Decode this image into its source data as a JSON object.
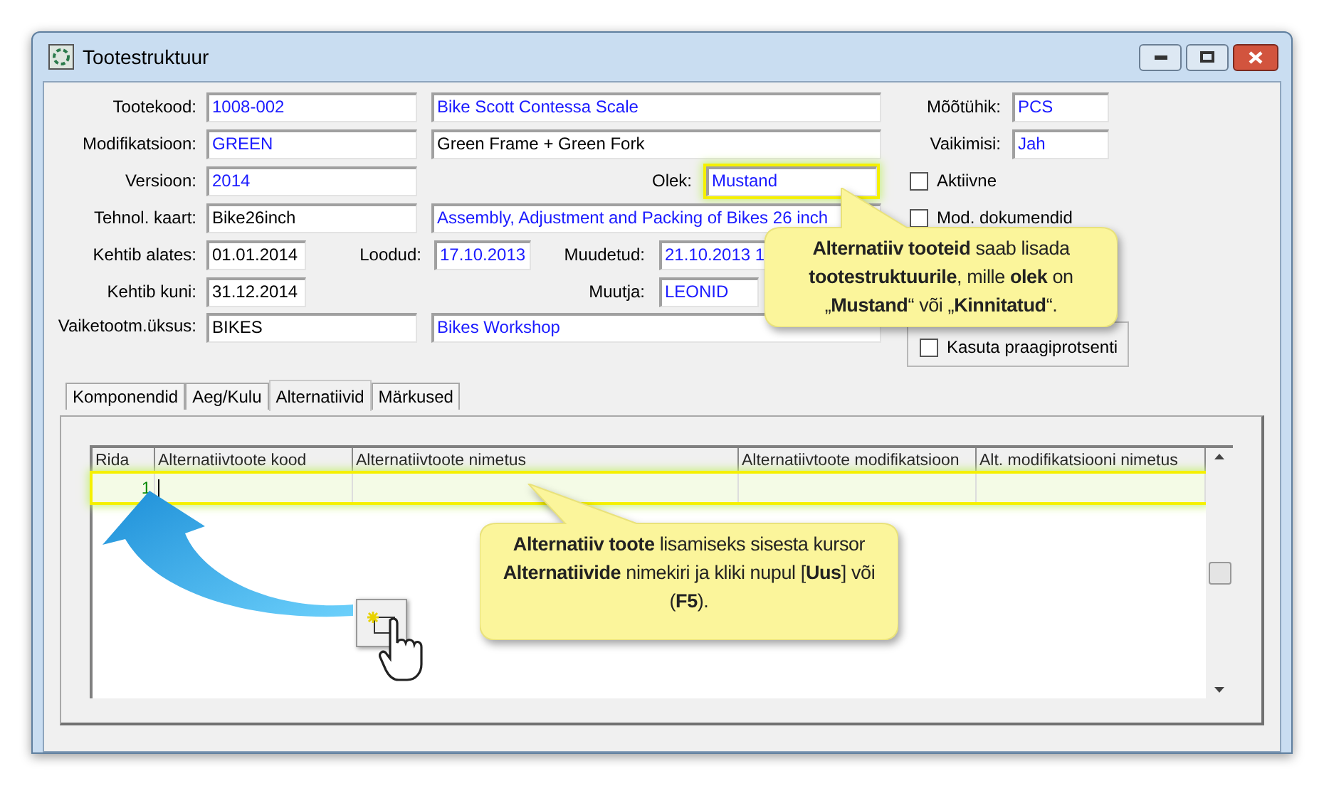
{
  "window": {
    "title": "Tootestruktuur"
  },
  "header": {
    "product_code": {
      "label": "Tootekood:",
      "value": "1008-002",
      "kind": "lookup"
    },
    "product_name": {
      "value": "Bike Scott Contessa Scale",
      "kind": "lookup"
    },
    "unit": {
      "label": "Mõõtühik:",
      "value": "PCS",
      "kind": "lookup"
    },
    "modification": {
      "label": "Modifikatsioon:",
      "value": "GREEN",
      "kind": "lookup"
    },
    "modification_name": {
      "value": "Green Frame + Green Fork",
      "kind": "text"
    },
    "default": {
      "label": "Vaikimisi:",
      "value": "Jah",
      "kind": "lookup"
    },
    "version": {
      "label": "Versioon:",
      "value": "2014",
      "kind": "lookup"
    },
    "status": {
      "label": "Olek:",
      "value": "Mustand",
      "kind": "lookup",
      "highlighted": true
    },
    "active": {
      "label": "Aktiivne",
      "checked": false
    },
    "tech_card": {
      "label": "Tehnol. kaart:",
      "value": "Bike26inch",
      "kind": "text"
    },
    "tech_card_name": {
      "value": "Assembly, Adjustment and Packing of Bikes 26 inch",
      "kind": "lookup"
    },
    "mod_documents": {
      "label": "Mod. dokumendid",
      "checked": false
    },
    "valid_from": {
      "label": "Kehtib alates:",
      "value": "01.01.2014",
      "kind": "text"
    },
    "created": {
      "label": "Loodud:",
      "value": "17.10.2013",
      "kind": "lookup"
    },
    "modified": {
      "label": "Muudetud:",
      "value": "21.10.2013 1",
      "kind": "lookup"
    },
    "valid_to": {
      "label": "Kehtib kuni:",
      "value": "31.12.2014",
      "kind": "text"
    },
    "modifier": {
      "label": "Muutja:",
      "value": "LEONID",
      "kind": "lookup"
    },
    "unit_dept": {
      "label": "Vaiketootm.üksus:",
      "value": "BIKES",
      "kind": "text"
    },
    "unit_dept_name": {
      "value": "Bikes Workshop",
      "kind": "lookup"
    },
    "use_scrap": {
      "label": "Kasuta praagiprotsenti",
      "checked": false
    }
  },
  "tabs": [
    {
      "label": "Komponendid",
      "selected": false
    },
    {
      "label": "Aeg/Kulu",
      "selected": false
    },
    {
      "label": "Alternatiivid",
      "selected": true
    },
    {
      "label": "Märkused",
      "selected": false
    }
  ],
  "table": {
    "columns": [
      "Rida",
      "Alternatiivtoote kood",
      "Alternatiivtoote nimetus",
      "Alternatiivtoote modifikatsioon",
      "Alt. modifikatsiooni nimetus"
    ],
    "rows": [
      {
        "cells": [
          "1",
          "",
          "",
          "",
          ""
        ],
        "highlighted": true
      }
    ]
  },
  "callouts": [
    {
      "text": "**Alternatiiv tooteid** saab lisada **tootestruktuurile**, mille **olek** on „**Mustand**“ või „**Kinnitatud**“."
    },
    {
      "text": "**Alternatiiv toote** lisamiseks sisesta kursor **Alternatiivide** nimekiri ja kliki nupul [**Uus**] või (**F5**)."
    }
  ]
}
